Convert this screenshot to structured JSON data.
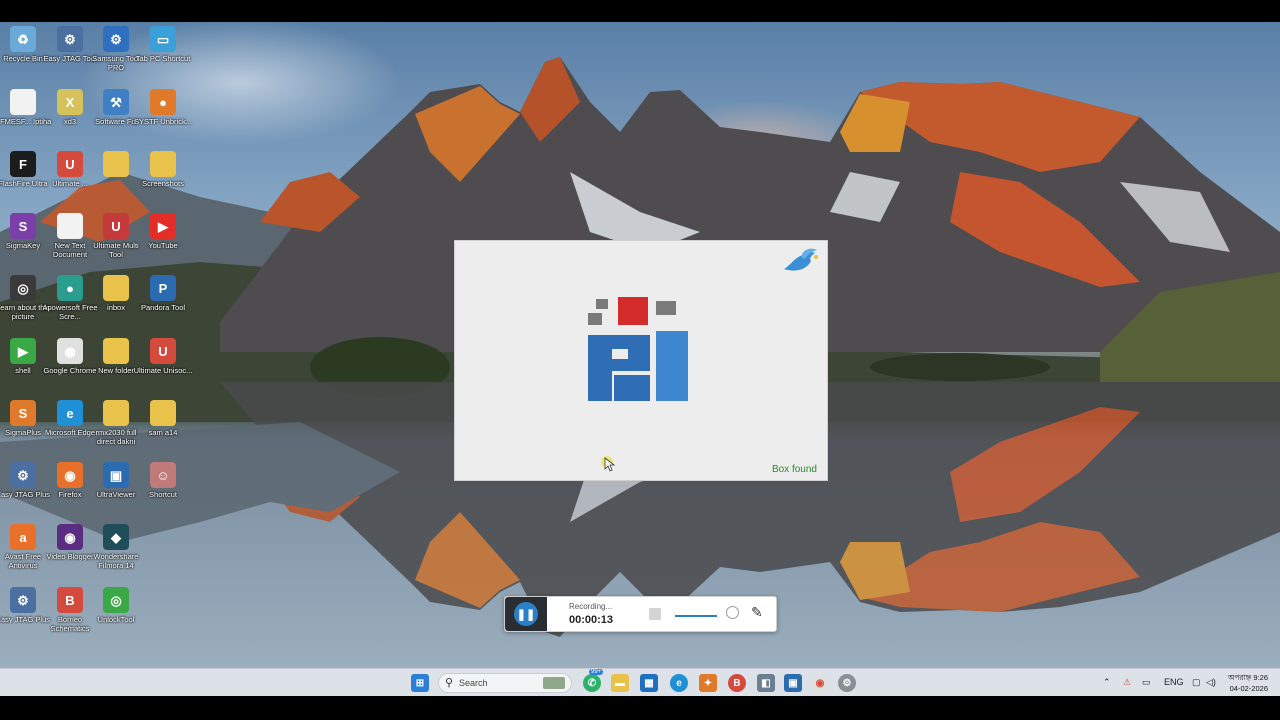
{
  "desktop": {
    "icons": [
      {
        "label": "Recycle Bin",
        "icon": "recycle-bin-icon",
        "color": "#6aa9d8",
        "glyph": "♻"
      },
      {
        "label": "Easy JTAG Tool",
        "icon": "easy-jtag-icon",
        "color": "#4a6fa0",
        "glyph": "⚙"
      },
      {
        "label": "Samsung Tool PRO",
        "icon": "samsung-tool-icon",
        "color": "#2e6fc0",
        "glyph": "⚙"
      },
      {
        "label": "Tab PC Shortcut",
        "icon": "tab-pc-icon",
        "color": "#3aa0d8",
        "glyph": "▭"
      },
      {
        "label": "CFMESF... Iptiha",
        "icon": "text-file-icon",
        "color": "#f2f2f2",
        "glyph": ""
      },
      {
        "label": "xd3",
        "icon": "xd3-icon",
        "color": "#d6c25a",
        "glyph": "X"
      },
      {
        "label": "Software Fix",
        "icon": "software-fix-icon",
        "color": "#3f7fc4",
        "glyph": "⚒"
      },
      {
        "label": "SYSTF Unbrick...",
        "icon": "unbrick-icon",
        "color": "#e07a2a",
        "glyph": "●"
      },
      {
        "label": "FlashFire Ultra",
        "icon": "flashfire-icon",
        "color": "#1c1c1c",
        "glyph": "F"
      },
      {
        "label": "Ultimate ...",
        "icon": "ultimate-icon",
        "color": "#d44b3e",
        "glyph": "U"
      },
      {
        "label": "",
        "icon": "folder-icon",
        "color": "#e8c24a",
        "glyph": ""
      },
      {
        "label": "Screenshots",
        "icon": "folder-icon",
        "color": "#e8c24a",
        "glyph": ""
      },
      {
        "label": "SigmaKey",
        "icon": "sigma-icon",
        "color": "#7a3fa8",
        "glyph": "S"
      },
      {
        "label": "New Text Document",
        "icon": "text-file-icon",
        "color": "#f2f2f2",
        "glyph": ""
      },
      {
        "label": "Ultimate Multi Tool",
        "icon": "umt-icon",
        "color": "#c43a3a",
        "glyph": "U"
      },
      {
        "label": "YouTube",
        "icon": "youtube-icon",
        "color": "#e52d27",
        "glyph": "▶"
      },
      {
        "label": "Learn about this picture",
        "icon": "learn-picture-icon",
        "color": "#3a3a3a",
        "glyph": "◎"
      },
      {
        "label": "Apowersoft Free Scre...",
        "icon": "apowersoft-icon",
        "color": "#2a9d8f",
        "glyph": "●"
      },
      {
        "label": "inbox",
        "icon": "folder-icon",
        "color": "#e8c24a",
        "glyph": ""
      },
      {
        "label": "Pandora Tool",
        "icon": "pandora-icon",
        "color": "#2b6cb0",
        "glyph": "P"
      },
      {
        "label": "shell",
        "icon": "shell-icon",
        "color": "#39a845",
        "glyph": "▶"
      },
      {
        "label": "Google Chrome",
        "icon": "chrome-icon",
        "color": "#e0e0e0",
        "glyph": "◉"
      },
      {
        "label": "New folder",
        "icon": "folder-icon",
        "color": "#e8c24a",
        "glyph": ""
      },
      {
        "label": "Ultimate Unisoc...",
        "icon": "unisoc-icon",
        "color": "#d44b3e",
        "glyph": "U"
      },
      {
        "label": "SigmaPlus",
        "icon": "sigmaplus-icon",
        "color": "#e07a2a",
        "glyph": "S"
      },
      {
        "label": "Microsoft Edge",
        "icon": "edge-icon",
        "color": "#1f8fd6",
        "glyph": "e"
      },
      {
        "label": "rmx2030 full direct dakni",
        "icon": "folder-icon",
        "color": "#e8c24a",
        "glyph": ""
      },
      {
        "label": "sam a14",
        "icon": "folder-icon",
        "color": "#e8c24a",
        "glyph": ""
      },
      {
        "label": "Easy JTAG Plus",
        "icon": "easy-jtag-plus-icon",
        "color": "#4a6fa0",
        "glyph": "⚙"
      },
      {
        "label": "Firefox",
        "icon": "firefox-icon",
        "color": "#e8702a",
        "glyph": "◉"
      },
      {
        "label": "UltraViewer",
        "icon": "ultraviewer-icon",
        "color": "#2b6cb0",
        "glyph": "▣"
      },
      {
        "label": "Shortcut",
        "icon": "photo-shortcut-icon",
        "color": "#c07a7a",
        "glyph": "☺"
      },
      {
        "label": "Avast Free Antivirus",
        "icon": "avast-icon",
        "color": "#e8702a",
        "glyph": "a"
      },
      {
        "label": "Video Blogger",
        "icon": "video-blogger-icon",
        "color": "#5a2d82",
        "glyph": "◉"
      },
      {
        "label": "Wondershare Filmora 14",
        "icon": "filmora-icon",
        "color": "#1f4e5a",
        "glyph": "◆"
      },
      {
        "label": "",
        "icon": "",
        "color": "",
        "glyph": ""
      },
      {
        "label": "Easy JTAG Plus",
        "icon": "easy-jtag-plus-icon",
        "color": "#4a6fa0",
        "glyph": "⚙"
      },
      {
        "label": "Borneo Schematics",
        "icon": "borneo-icon",
        "color": "#d44b3e",
        "glyph": "B"
      },
      {
        "label": "UnlockTool",
        "icon": "unlocktool-icon",
        "color": "#39a845",
        "glyph": "◎"
      }
    ]
  },
  "splash": {
    "status": "Box found",
    "logo": "pandora-logo-icon"
  },
  "recorder": {
    "status": "Recording...",
    "time": "00:00:13"
  },
  "taskbar": {
    "search_label": "Search",
    "badge": "99+",
    "lang": "ENG",
    "time": "অপরাহ্ন 9:26",
    "date": "04-02-2026"
  }
}
